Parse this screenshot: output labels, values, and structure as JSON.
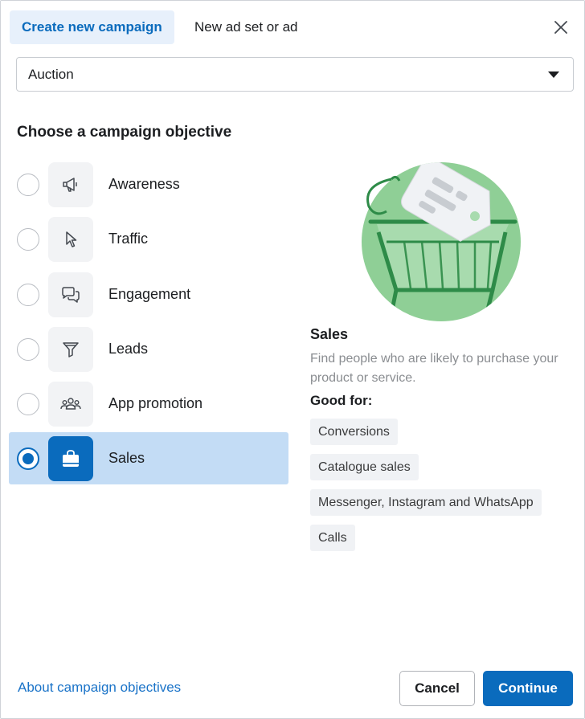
{
  "tabs": [
    {
      "label": "Create new campaign",
      "active": true
    },
    {
      "label": "New ad set or ad",
      "active": false
    }
  ],
  "buying_type": {
    "value": "Auction"
  },
  "section_title": "Choose a campaign objective",
  "objectives": [
    {
      "label": "Awareness",
      "icon": "megaphone-icon",
      "selected": false
    },
    {
      "label": "Traffic",
      "icon": "cursor-icon",
      "selected": false
    },
    {
      "label": "Engagement",
      "icon": "chat-bubbles-icon",
      "selected": false
    },
    {
      "label": "Leads",
      "icon": "funnel-icon",
      "selected": false
    },
    {
      "label": "App promotion",
      "icon": "people-group-icon",
      "selected": false
    },
    {
      "label": "Sales",
      "icon": "shopping-bag-icon",
      "selected": true
    }
  ],
  "detail": {
    "title": "Sales",
    "description": "Find people who are likely to purchase your product or service.",
    "good_for_label": "Good for:",
    "good_for": [
      "Conversions",
      "Catalogue sales",
      "Messenger, Instagram and WhatsApp",
      "Calls"
    ],
    "illustration": "shopping-cart-with-tag"
  },
  "footer": {
    "link": "About campaign objectives",
    "cancel": "Cancel",
    "continue": "Continue"
  },
  "colors": {
    "accent": "#0a6bbd",
    "selected_bg": "#c3dcf5",
    "illustration_green": "#8fcf96"
  }
}
